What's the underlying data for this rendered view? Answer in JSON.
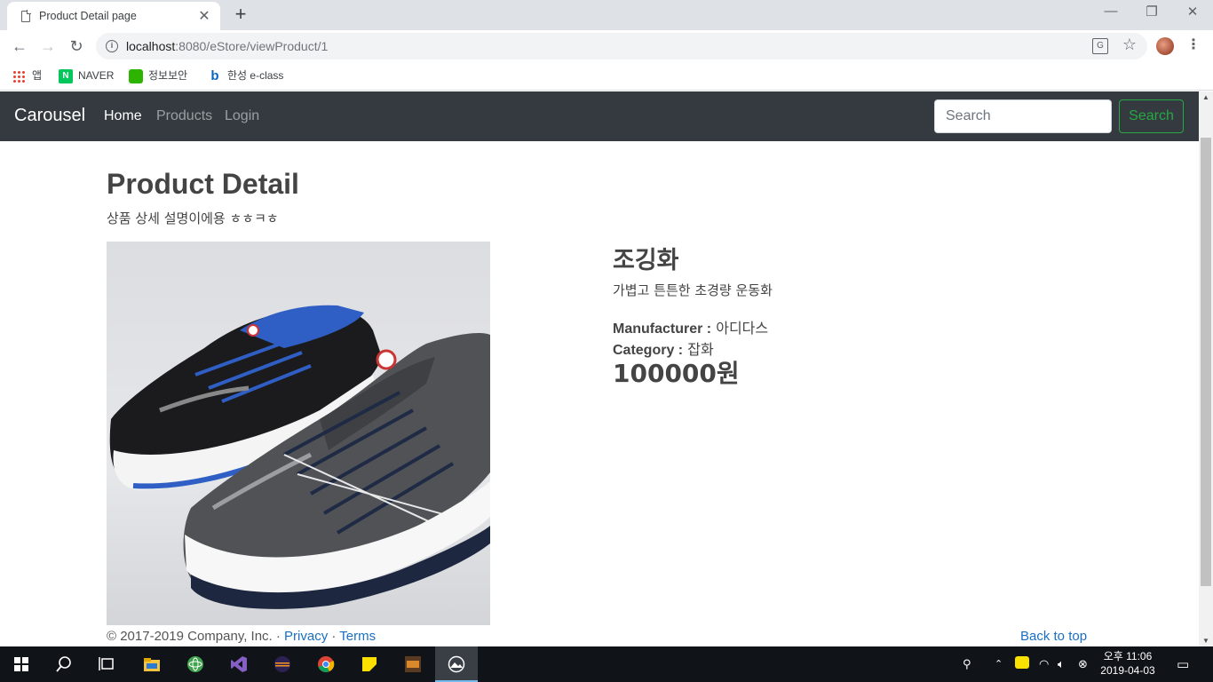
{
  "browser": {
    "tab_title": "Product Detail page",
    "url_host": "localhost",
    "url_rest": ":8080/eStore/viewProduct/1",
    "bookmarks": [
      "앱",
      "NAVER",
      "정보보안",
      "한성 e-class"
    ]
  },
  "nav": {
    "brand": "Carousel",
    "links": [
      "Home",
      "Products",
      "Login"
    ],
    "search_placeholder": "Search",
    "search_button": "Search"
  },
  "page": {
    "title": "Product Detail",
    "subtitle": "상품 상세 설명이에용 ㅎㅎㅋㅎ"
  },
  "product": {
    "name": "조깅화",
    "description": "가볍고 튼튼한 초경량 운동화",
    "manufacturer_label": "Manufacturer :",
    "manufacturer": "아디다스",
    "category_label": "Category :",
    "category": "잡화",
    "price": "100000원"
  },
  "footer": {
    "copyright": "© 2017-2019 Company, Inc. · ",
    "privacy": "Privacy",
    "separator": " · ",
    "terms": "Terms",
    "back_to_top": "Back to top"
  },
  "taskbar": {
    "clock_time": "오후 11:06",
    "clock_date": "2019-04-03"
  },
  "colors": {
    "navbar_bg": "#343a40",
    "search_button": "#28a745",
    "link": "#1a6fc4"
  }
}
